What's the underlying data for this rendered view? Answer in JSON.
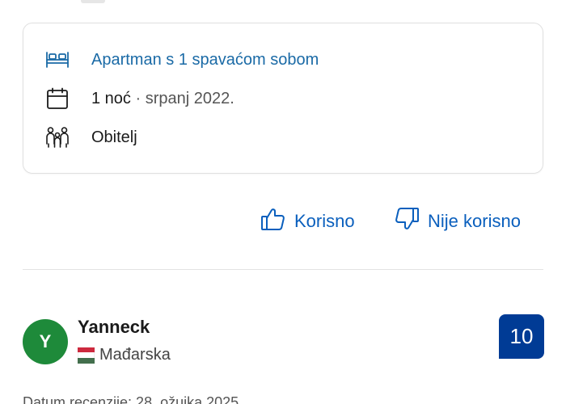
{
  "stay": {
    "room": "Apartman s 1 spavaćom sobom",
    "nights": "1 noć",
    "separator": "·",
    "month": "srpanj 2022.",
    "traveler_type": "Obitelj"
  },
  "feedback": {
    "helpful_label": "Korisno",
    "not_helpful_label": "Nije korisno"
  },
  "reviewer": {
    "initial": "Y",
    "name": "Yanneck",
    "country": "Mađarska",
    "score": "10"
  },
  "review": {
    "date": "Datum recenzije: 28. ožujka 2025."
  },
  "icons": {
    "room": "bed-icon",
    "date": "calendar-icon",
    "group": "family-icon",
    "helpful": "thumbs-up-icon",
    "not_helpful": "thumbs-down-icon",
    "flag": "hungary-flag-icon"
  },
  "colors": {
    "link": "#0a5fbd",
    "room_text": "#1a6aa6",
    "avatar": "#1e8a3a",
    "score_badge": "#003b95"
  }
}
